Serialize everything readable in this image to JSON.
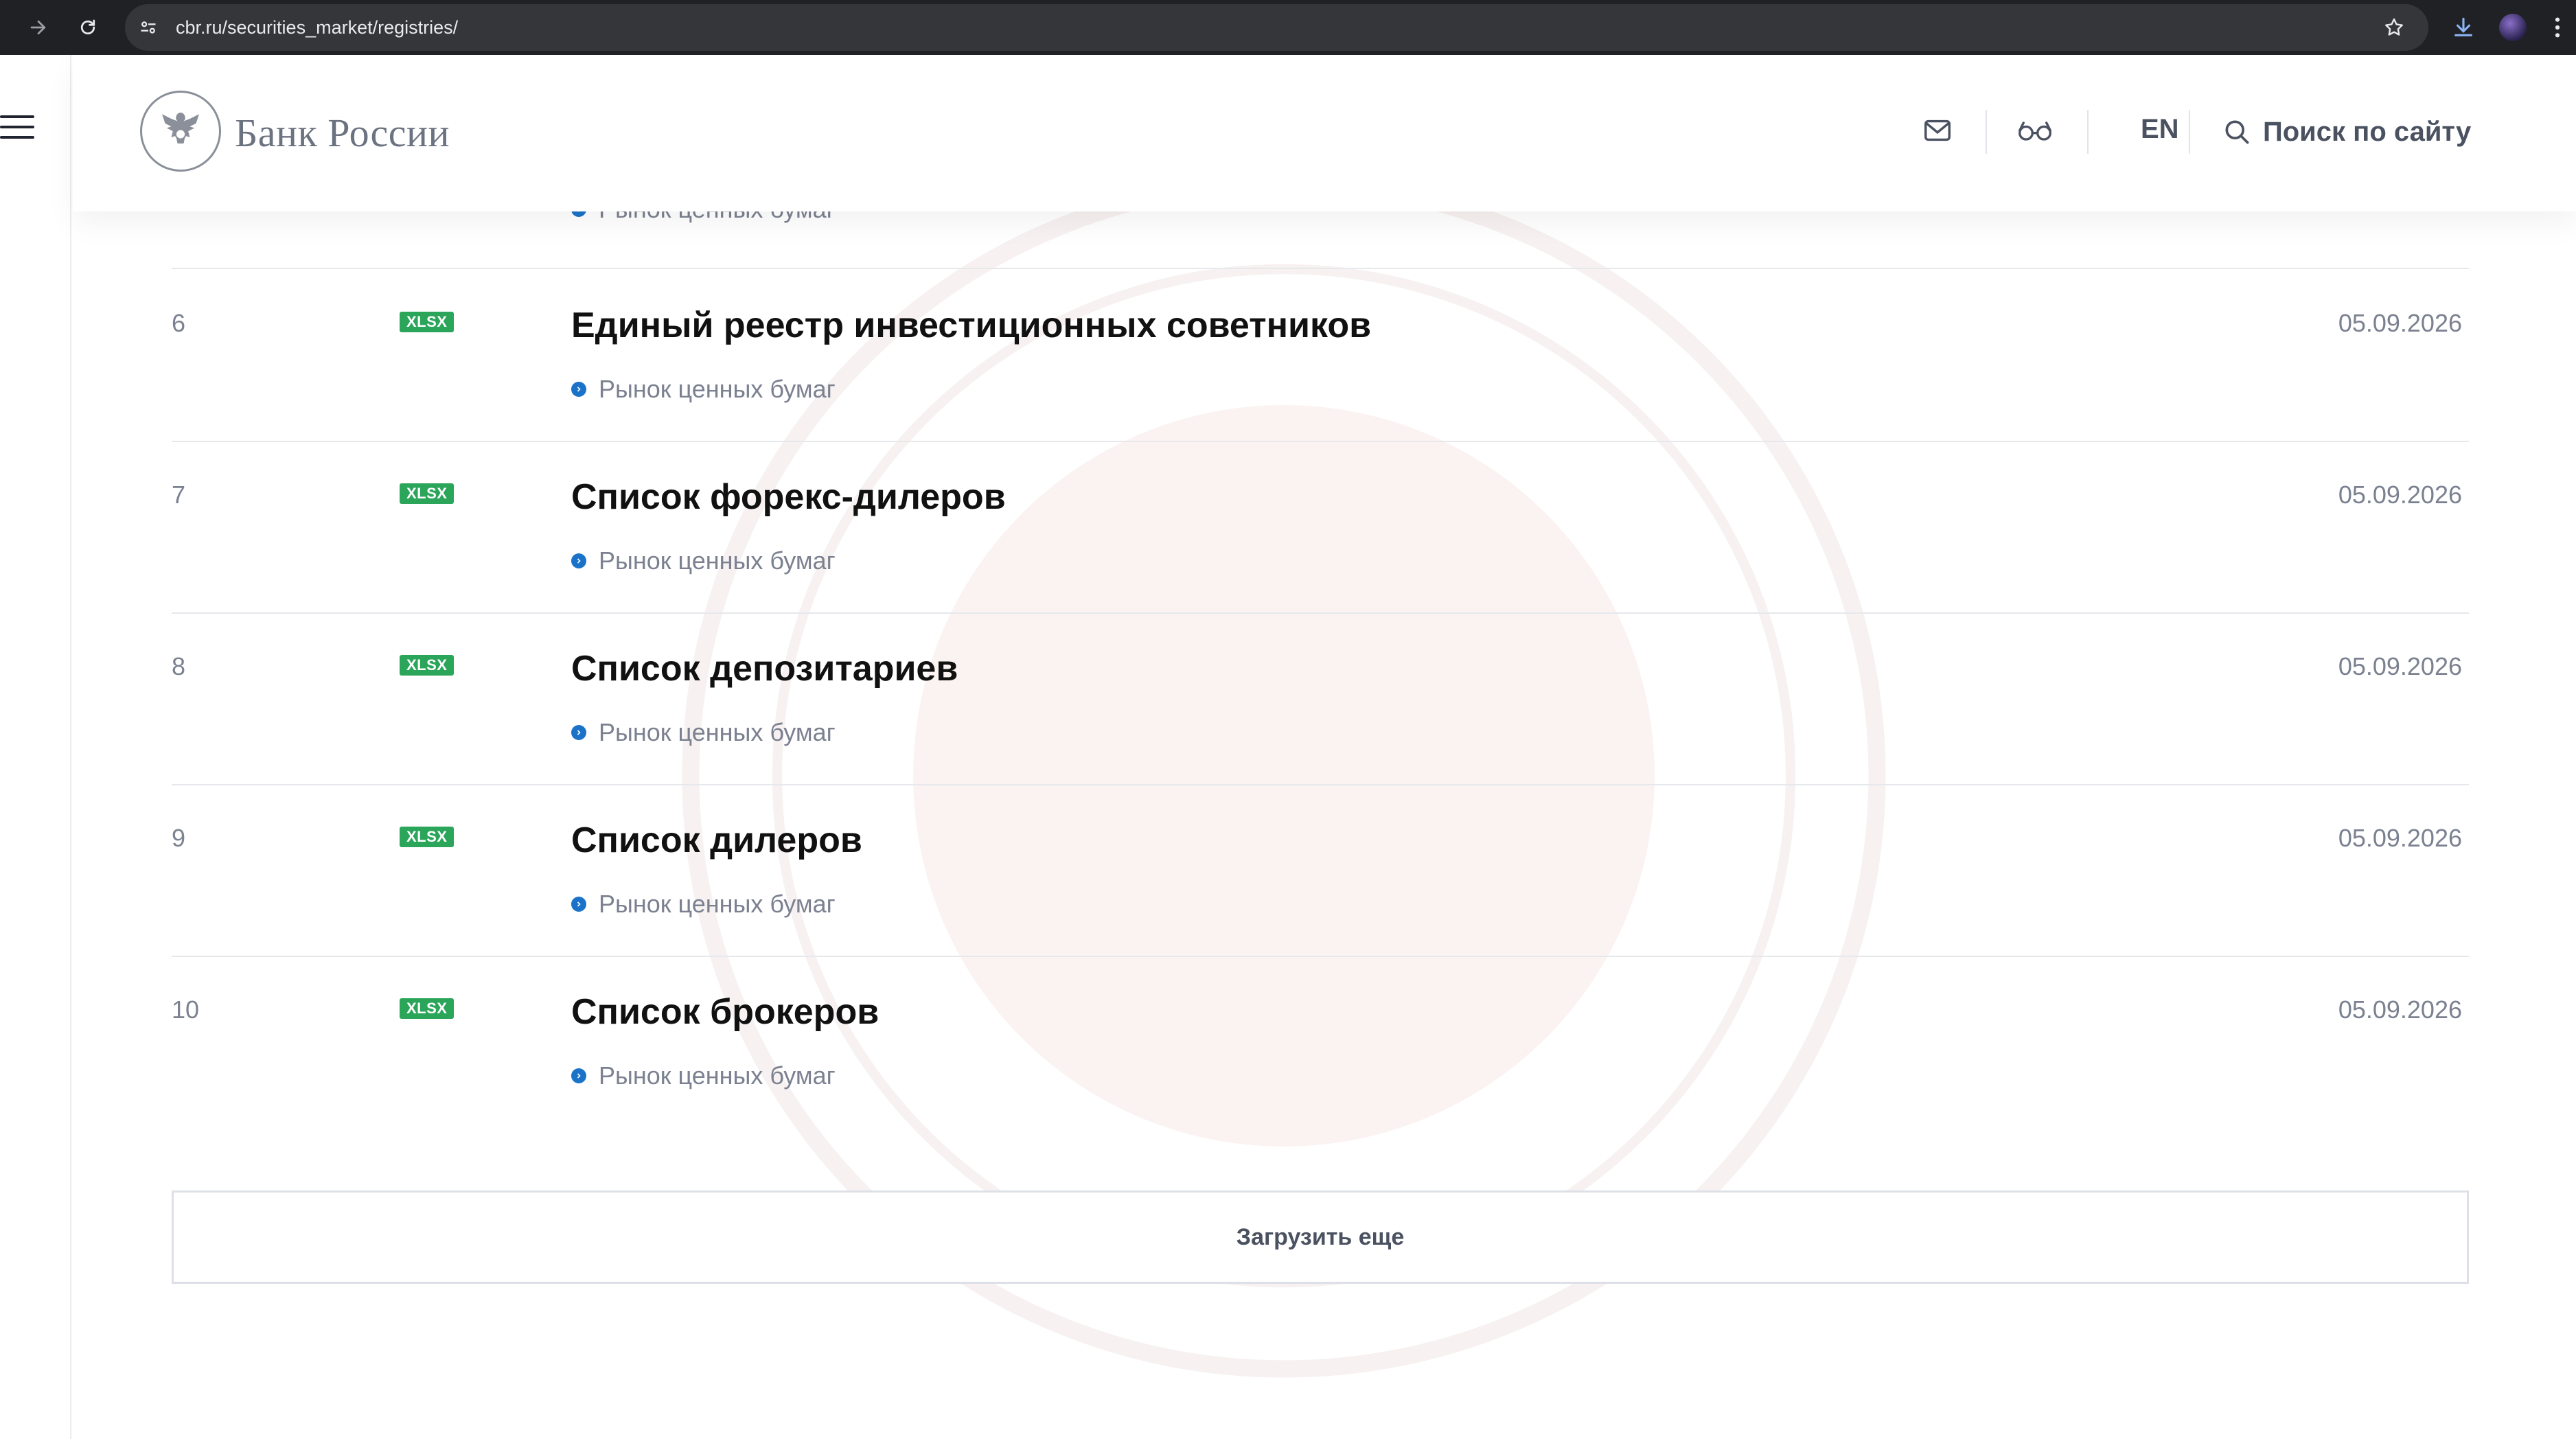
{
  "browser": {
    "url": "cbr.ru/securities_market/registries/",
    "icons": [
      "forward-icon",
      "reload-icon",
      "site-settings-icon",
      "bookmark-star-icon",
      "download-icon",
      "profile-avatar",
      "more-menu-icon"
    ]
  },
  "header": {
    "logo_text": "Банк России",
    "lang": "EN",
    "search_label": "Поиск по сайту",
    "icons": [
      "mail-icon",
      "glasses-icon",
      "search-icon"
    ]
  },
  "list": {
    "prev_tag": "Рынок ценных бумаг",
    "rows": [
      {
        "num": "6",
        "format": "XLSX",
        "title": "Единый реестр инвестиционных советников",
        "tag": "Рынок ценных бумаг",
        "date": "05.09.2026"
      },
      {
        "num": "7",
        "format": "XLSX",
        "title": "Список форекс-дилеров",
        "tag": "Рынок ценных бумаг",
        "date": "05.09.2026"
      },
      {
        "num": "8",
        "format": "XLSX",
        "title": "Список депозитариев",
        "tag": "Рынок ценных бумаг",
        "date": "05.09.2026"
      },
      {
        "num": "9",
        "format": "XLSX",
        "title": "Список дилеров",
        "tag": "Рынок ценных бумаг",
        "date": "05.09.2026"
      },
      {
        "num": "10",
        "format": "XLSX",
        "title": "Список брокеров",
        "tag": "Рынок ценных бумаг",
        "date": "05.09.2026"
      }
    ],
    "load_more_label": "Загрузить еще"
  },
  "colors": {
    "badge_green": "#2aa55a",
    "tag_dot_blue": "#1a73c9",
    "chrome_dark": "#202124"
  }
}
